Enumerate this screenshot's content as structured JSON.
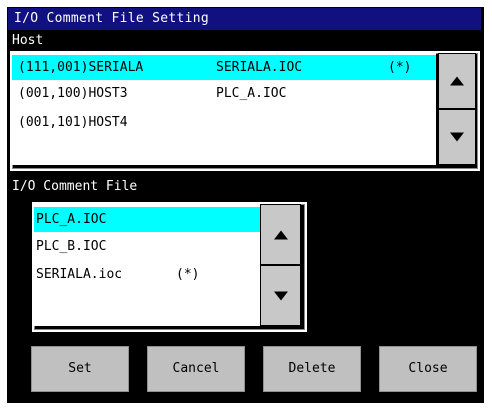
{
  "window": {
    "title": "I/O Comment File Setting"
  },
  "host": {
    "label": "Host",
    "rows": [
      {
        "address": "(111,001)SERIALA",
        "file": "SERIALA.IOC",
        "mark": "(*)"
      },
      {
        "address": "(001,100)HOST3",
        "file": "PLC_A.IOC",
        "mark": ""
      },
      {
        "address": "(001,101)HOST4",
        "file": "",
        "mark": ""
      }
    ]
  },
  "comment_file": {
    "label": "I/O Comment File",
    "rows": [
      {
        "name": "PLC_A.IOC",
        "mark": ""
      },
      {
        "name": "PLC_B.IOC",
        "mark": ""
      },
      {
        "name": "SERIALA.ioc",
        "mark": "(*)"
      }
    ]
  },
  "buttons": {
    "set": "Set",
    "cancel": "Cancel",
    "delete": "Delete",
    "close": "Close"
  },
  "colors": {
    "title_bg": "#101080",
    "selection": "#00ffff",
    "button": "#c0c0c0"
  }
}
